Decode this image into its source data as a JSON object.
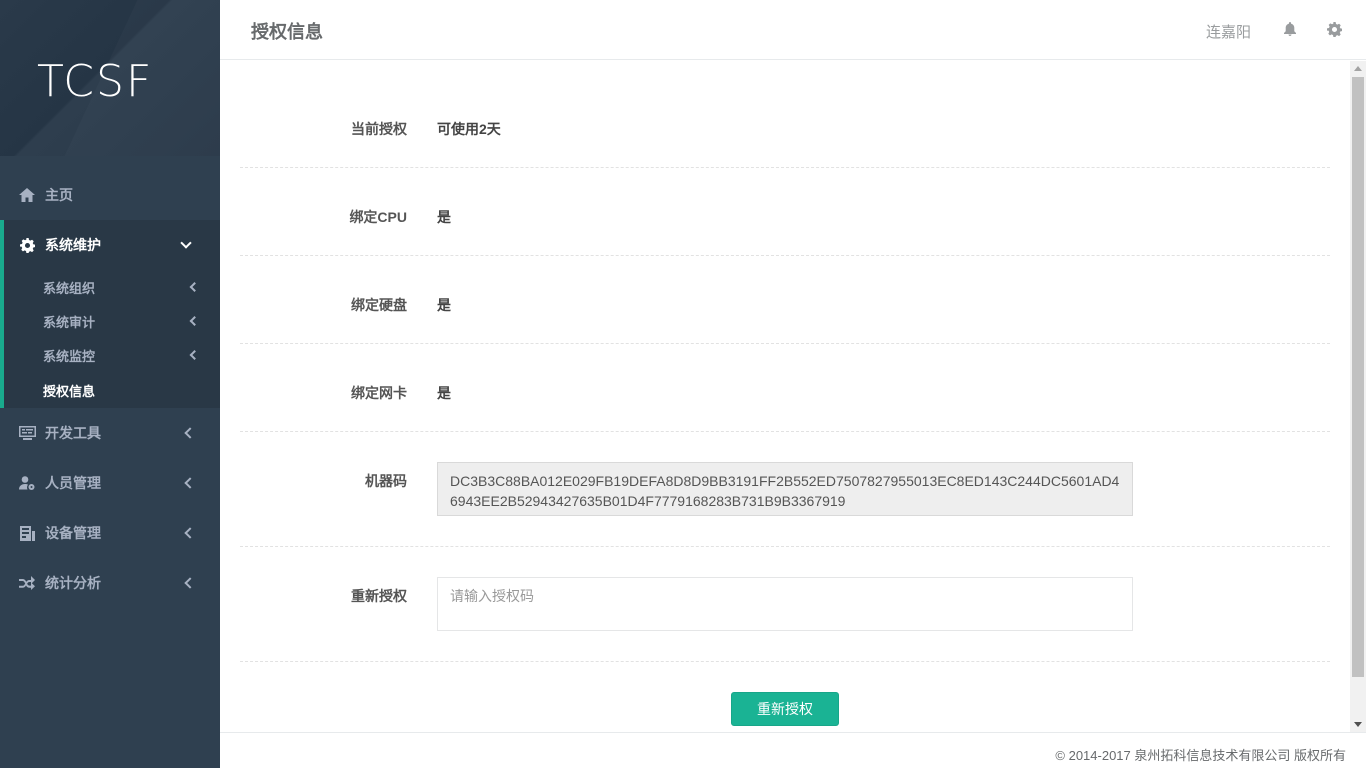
{
  "sidebar": {
    "logo": "TCSF",
    "home": "主页",
    "system_maintenance": "系统维护",
    "sub_items": [
      "系统组织",
      "系统审计",
      "系统监控",
      "授权信息"
    ],
    "dev_tools": "开发工具",
    "personnel": "人员管理",
    "devices": "设备管理",
    "stats": "统计分析"
  },
  "header": {
    "title": "授权信息",
    "user": "连嘉阳",
    "icons": [
      "bell-icon",
      "gear-icon"
    ]
  },
  "license": {
    "current_label": "当前授权",
    "current_value": "可使用2天",
    "cpu_label": "绑定CPU",
    "cpu_value": "是",
    "disk_label": "绑定硬盘",
    "disk_value": "是",
    "nic_label": "绑定网卡",
    "nic_value": "是",
    "machine_label": "机器码",
    "machine_code": "DC3B3C88BA012E029FB19DEFA8D8D9BB3191FF2B552ED7507827955013EC8ED143C244DC5601AD46943EE2B52943427635B01D4F7779168283B731B9B3367919",
    "reauth_label": "重新授权",
    "reauth_placeholder": "请输入授权码",
    "reauth_button": "重新授权"
  },
  "footer": {
    "copyright": "© 2014-2017 泉州拓科信息技术有限公司 版权所有"
  },
  "colors": {
    "sidebar_bg": "#2f4050",
    "accent": "#1ab394"
  }
}
